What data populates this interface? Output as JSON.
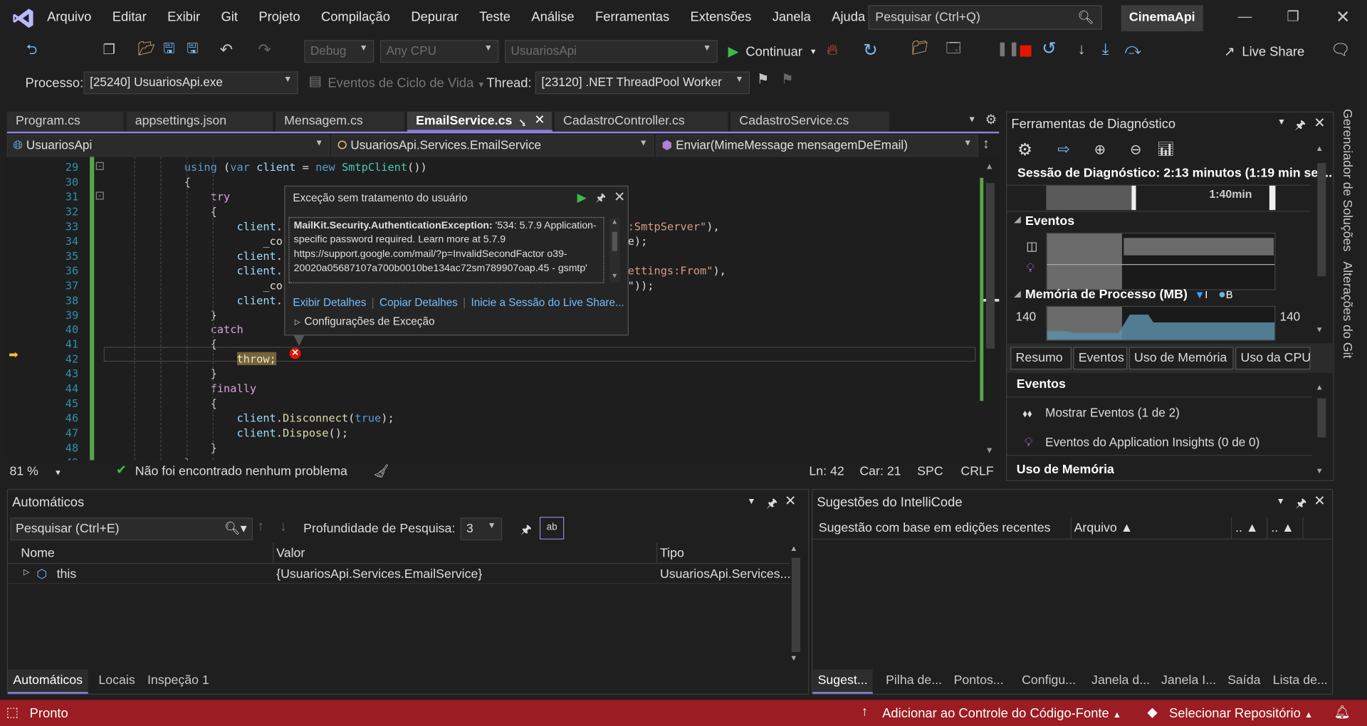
{
  "title_bar": {
    "menu": [
      "Arquivo",
      "Editar",
      "Exibir",
      "Git",
      "Projeto",
      "Compilação",
      "Depurar",
      "Teste",
      "Análise",
      "Ferramentas",
      "Extensões",
      "Janela",
      "Ajuda"
    ],
    "search_placeholder": "Pesquisar (Ctrl+Q)",
    "solution": "CinemaApi"
  },
  "toolbar": {
    "config": "Debug",
    "platform": "Any CPU",
    "startup": "UsuariosApi",
    "continue": "Continuar",
    "live_share": "Live Share"
  },
  "debug_bar": {
    "process_label": "Processo:",
    "process": "[25240] UsuariosApi.exe",
    "lifecycle": "Eventos de Ciclo de Vida",
    "thread_label": "Thread:",
    "thread": "[23120] .NET ThreadPool Worker"
  },
  "tabs": [
    "Program.cs",
    "appsettings.json",
    "Mensagem.cs",
    "EmailService.cs",
    "CadastroController.cs",
    "CadastroService.cs"
  ],
  "active_tab": "EmailService.cs",
  "navbar": {
    "project": "UsuariosApi",
    "class": "UsuariosApi.Services.EmailService",
    "member": "Enviar(MimeMessage mensagemDeEmail)"
  },
  "code": [
    {
      "n": "29",
      "segs": [
        [
          "            ",
          ""
        ],
        [
          "using",
          "kw"
        ],
        [
          " (",
          ""
        ],
        [
          "var",
          "kw"
        ],
        [
          " ",
          ""
        ],
        [
          "client",
          "id"
        ],
        [
          " = ",
          ""
        ],
        [
          "new",
          "kw"
        ],
        [
          " ",
          ""
        ],
        [
          "SmtpClient",
          "cls"
        ],
        [
          "())",
          ""
        ]
      ]
    },
    {
      "n": "30",
      "segs": [
        [
          "            {",
          ""
        ]
      ]
    },
    {
      "n": "31",
      "segs": [
        [
          "                ",
          ""
        ],
        [
          "try",
          "ctl"
        ]
      ]
    },
    {
      "n": "32",
      "segs": [
        [
          "                {",
          ""
        ]
      ]
    },
    {
      "n": "33",
      "segs": [
        [
          "                    ",
          ""
        ],
        [
          "client",
          "id"
        ],
        [
          ".",
          ""
        ]
      ],
      "tail": [
        [
          "gs:SmtpServer\"",
          "str"
        ],
        [
          "),",
          ""
        ]
      ]
    },
    {
      "n": "34",
      "segs": [
        [
          "                        _co",
          ""
        ]
      ],
      "tail": [
        [
          "e);",
          ""
        ]
      ]
    },
    {
      "n": "35",
      "segs": [
        [
          "                    ",
          ""
        ],
        [
          "client",
          "id"
        ],
        [
          ".",
          ""
        ]
      ]
    },
    {
      "n": "36",
      "segs": [
        [
          "                    ",
          ""
        ],
        [
          "client",
          "id"
        ],
        [
          ".",
          ""
        ]
      ],
      "tail": [
        [
          "ettings:From\"",
          "str"
        ],
        [
          "),",
          ""
        ]
      ]
    },
    {
      "n": "37",
      "segs": [
        [
          "                        _co",
          ""
        ]
      ],
      "tail": [
        [
          "\"));",
          ""
        ]
      ]
    },
    {
      "n": "38",
      "segs": [
        [
          "                    ",
          ""
        ],
        [
          "client",
          "id"
        ],
        [
          ".",
          ""
        ]
      ]
    },
    {
      "n": "39",
      "segs": [
        [
          "                }",
          ""
        ]
      ]
    },
    {
      "n": "40",
      "segs": [
        [
          "                ",
          ""
        ],
        [
          "catch",
          "ctl"
        ]
      ]
    },
    {
      "n": "41",
      "segs": [
        [
          "                {",
          ""
        ]
      ]
    },
    {
      "n": "42",
      "segs": [
        [
          "                    ",
          ""
        ],
        [
          "throw;",
          "ctl hl"
        ]
      ]
    },
    {
      "n": "43",
      "segs": [
        [
          "                }",
          ""
        ]
      ]
    },
    {
      "n": "44",
      "segs": [
        [
          "                ",
          ""
        ],
        [
          "finally",
          "ctl"
        ]
      ]
    },
    {
      "n": "45",
      "segs": [
        [
          "                {",
          ""
        ]
      ]
    },
    {
      "n": "46",
      "segs": [
        [
          "                    ",
          ""
        ],
        [
          "client",
          "id"
        ],
        [
          ".",
          ""
        ],
        [
          "Disconnect",
          "fn"
        ],
        [
          "(",
          ""
        ],
        [
          "true",
          "kw"
        ],
        [
          ");",
          ""
        ]
      ]
    },
    {
      "n": "47",
      "segs": [
        [
          "                    ",
          ""
        ],
        [
          "client",
          "id"
        ],
        [
          ".",
          ""
        ],
        [
          "Dispose",
          "fn"
        ],
        [
          "();",
          ""
        ]
      ]
    },
    {
      "n": "48",
      "segs": [
        [
          "                }",
          ""
        ]
      ]
    },
    {
      "n": "49",
      "segs": [
        [
          "            }",
          ""
        ]
      ]
    }
  ],
  "exception": {
    "title": "Exceção sem tratamento do usuário",
    "type": "MailKit.Security.AuthenticationException:",
    "message": " '534: 5.7.9 Application-specific password required. Learn more at 5.7.9  https://support.google.com/mail/?p=InvalidSecondFactor o39-20020a05687107a700b0010be134ac72sm789907oap.45 - gsmtp'",
    "links": [
      "Exibir Detalhes",
      "Copiar Detalhes",
      "Inicie a Sessão do Live Share..."
    ],
    "settings": "Configurações de Exceção"
  },
  "editor_status": {
    "zoom": "81 %",
    "issues": "Não foi encontrado nenhum problema",
    "ln": "Ln: 42",
    "col": "Car: 21",
    "spc": "SPC",
    "eol": "CRLF"
  },
  "diag": {
    "title": "Ferramentas de Diagnóstico",
    "session": "Sessão de Diagnóstico: 2:13 minutos (1:19 min sel...",
    "time_mark": "1:40min",
    "events_label": "Eventos",
    "memory_label": "Memória de Processo (MB)",
    "legend": [
      "I",
      "B"
    ],
    "mem_left": "140",
    "mem_right": "140",
    "tabs": [
      "Resumo",
      "Eventos",
      "Uso de Memória",
      "Uso da CPU"
    ],
    "section": "Eventos",
    "items": [
      "Mostrar Eventos (1 de 2)",
      "Eventos do Application Insights (0 de 0)"
    ],
    "section2": "Uso de Memória"
  },
  "side_tabs": [
    "Gerenciador de Soluções",
    "Alterações do Git"
  ],
  "autos": {
    "title": "Automáticos",
    "search_placeholder": "Pesquisar (Ctrl+E)",
    "depth_label": "Profundidade de Pesquisa:",
    "depth": "3",
    "columns": [
      "Nome",
      "Valor",
      "Tipo"
    ],
    "rows": [
      {
        "name": "this",
        "value": "{UsuariosApi.Services.EmailService}",
        "type": "UsuariosApi.Services..."
      }
    ],
    "tabs": [
      "Automáticos",
      "Locais",
      "Inspeção 1"
    ]
  },
  "intellicode": {
    "title": "Sugestões do IntelliCode",
    "columns": [
      "Sugestão com base em edições recentes",
      "Arquivo",
      "..",
      ".."
    ],
    "tabs": [
      "Sugest...",
      "Pilha de...",
      "Pontos...",
      "Configu...",
      "Janela d...",
      "Janela I...",
      "Saída",
      "Lista de..."
    ]
  },
  "status_bar": {
    "ready": "Pronto",
    "source_control": "Adicionar ao Controle do Código-Fonte",
    "repo": "Selecionar Repositório",
    "color": "#9b1c22"
  }
}
